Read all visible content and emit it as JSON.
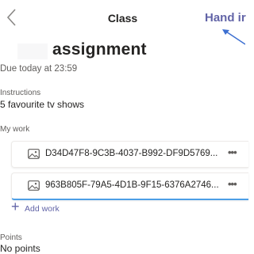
{
  "header": {
    "title": "Class",
    "hand_in_label": "Hand ir"
  },
  "assignment": {
    "title": "assignment",
    "due": "Due today at 23:59"
  },
  "instructions": {
    "heading": "Instructions",
    "text": "5 favourite tv shows"
  },
  "my_work": {
    "heading": "My work",
    "files": [
      {
        "name": "D34D47F8-9C3B-4037-B992-DF9D5769...",
        "more_label": "•••"
      },
      {
        "name": "963B805F-79A5-4D1B-9F15-6376A2746...",
        "more_label": "•••"
      }
    ],
    "add_work_label": "Add work"
  },
  "points": {
    "heading": "Points",
    "text": "No points"
  },
  "icons": {
    "back": "chevron-left-icon",
    "annotation": "arrow-annotation-icon",
    "file": "image-file-icon",
    "add": "plus-icon"
  },
  "colors": {
    "accent": "#6264a7",
    "annotation_arrow": "#3c6fd1",
    "focus_underline": "#4c9ee6"
  }
}
